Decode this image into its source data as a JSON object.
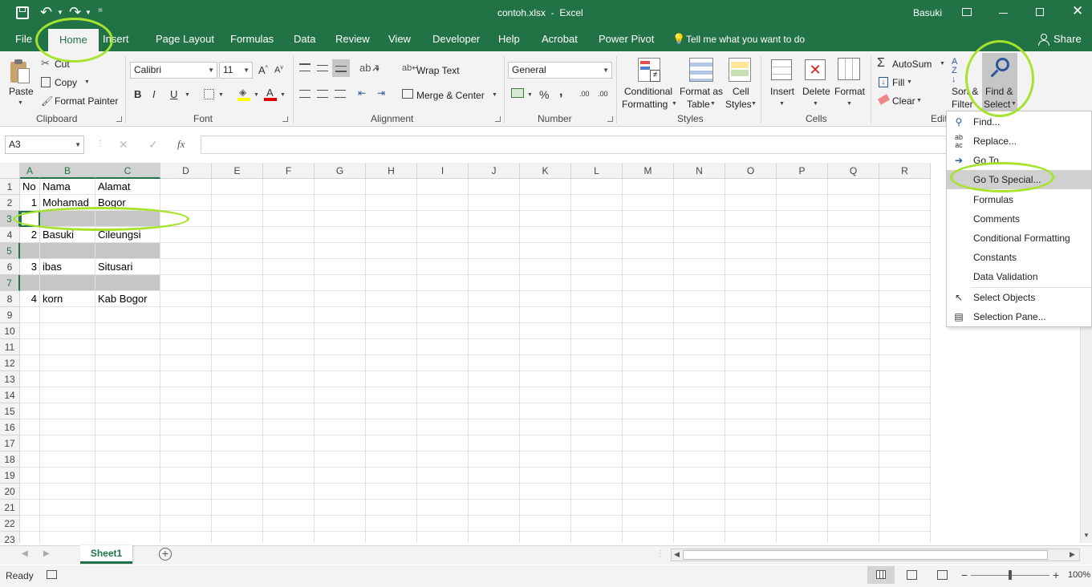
{
  "titlebar": {
    "title": "contoh.xlsx  -  Excel",
    "user": "Basuki",
    "qat_more": "="
  },
  "tabs": [
    "File",
    "Home",
    "Insert",
    "Page Layout",
    "Formulas",
    "Data",
    "Review",
    "View",
    "Developer",
    "Help",
    "Acrobat",
    "Power Pivot"
  ],
  "tell_me": "Tell me what you want to do",
  "share": "Share",
  "ribbon": {
    "clipboard": {
      "paste": "Paste",
      "cut": "Cut",
      "copy": "Copy",
      "format_painter": "Format Painter",
      "label": "Clipboard"
    },
    "font": {
      "name": "Calibri",
      "size": "11",
      "label": "Font",
      "bold": "B",
      "italic": "I",
      "underline": "U"
    },
    "alignment": {
      "wrap": "Wrap Text",
      "merge": "Merge & Center",
      "label": "Alignment"
    },
    "number": {
      "format": "General",
      "percent": "%",
      "comma": ",",
      "inc_dec": ".00",
      "label": "Number"
    },
    "styles": {
      "cond_line1": "Conditional",
      "cond_line2": "Formatting",
      "fmt_line1": "Format as",
      "fmt_line2": "Table",
      "cell_line1": "Cell",
      "cell_line2": "Styles",
      "label": "Styles"
    },
    "cells": {
      "insert": "Insert",
      "delete": "Delete",
      "format": "Format",
      "label": "Cells"
    },
    "editing": {
      "autosum": "AutoSum",
      "fill": "Fill",
      "clear": "Clear",
      "sort_line1": "Sort &",
      "sort_line2": "Filter",
      "find_line1": "Find &",
      "find_line2": "Select",
      "label": "Editi"
    }
  },
  "formula_bar": {
    "name_box": "A3",
    "fx": "fx",
    "value": ""
  },
  "columns": [
    "A",
    "B",
    "C",
    "D",
    "E",
    "F",
    "G",
    "H",
    "I",
    "J",
    "K",
    "L",
    "M",
    "N",
    "O",
    "P",
    "Q",
    "R"
  ],
  "rows": [
    "1",
    "2",
    "3",
    "4",
    "5",
    "6",
    "7",
    "8",
    "9",
    "10",
    "11",
    "12",
    "13",
    "14",
    "15",
    "16",
    "17",
    "18",
    "19",
    "20",
    "21",
    "22",
    "23"
  ],
  "cells": {
    "A1": "No",
    "B1": "Nama",
    "C1": "Alamat",
    "A2": "1",
    "B2": "Mohamad",
    "C2": "Bogor",
    "A4": "2",
    "B4": "Basuki",
    "C4": "Cileungsi",
    "A6": "3",
    "B6": "ibas",
    "C6": "Situsari",
    "A8": "4",
    "B8": "korn",
    "C8": "Kab Bogor"
  },
  "find_menu": [
    {
      "label": "Find...",
      "icon": "magnifier-icon"
    },
    {
      "label": "Replace...",
      "icon": "replace-icon"
    },
    {
      "label": "Go To...",
      "icon": "arrow-right-icon"
    },
    {
      "label": "Go To Special...",
      "icon": ""
    },
    {
      "label": "Formulas",
      "icon": ""
    },
    {
      "label": "Comments",
      "icon": ""
    },
    {
      "label": "Conditional Formatting",
      "icon": ""
    },
    {
      "label": "Constants",
      "icon": ""
    },
    {
      "label": "Data Validation",
      "icon": ""
    },
    {
      "label": "Select Objects",
      "icon": "pointer-icon"
    },
    {
      "label": "Selection Pane...",
      "icon": "selection-pane-icon"
    }
  ],
  "sheet_tabs": [
    "Sheet1"
  ],
  "status": {
    "ready": "Ready",
    "zoom": "100%",
    "minus": "−",
    "plus": "+"
  },
  "colors": {
    "brand": "#217346",
    "highlight_ring": "#a6e22e",
    "selected_cell": "#c6c6c6"
  }
}
